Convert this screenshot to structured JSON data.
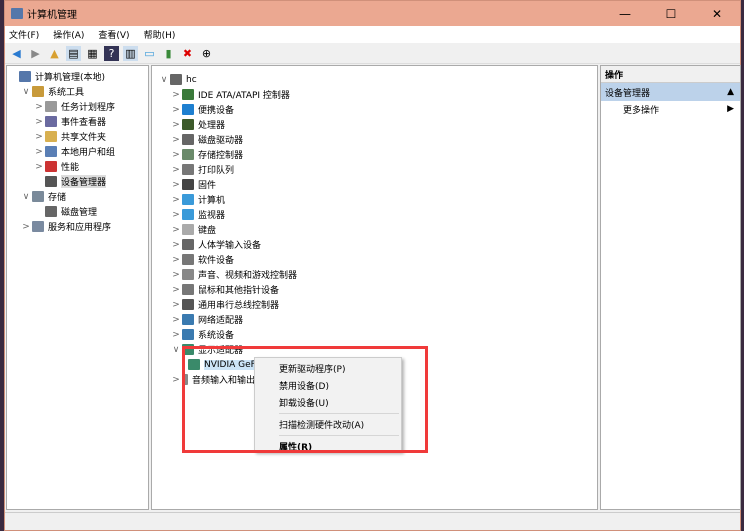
{
  "window": {
    "title": "计算机管理",
    "controls": [
      "—",
      "☐",
      "✕"
    ]
  },
  "menu": [
    "文件(F)",
    "操作(A)",
    "查看(V)",
    "帮助(H)"
  ],
  "left_tree": [
    {
      "label": "计算机管理(本地)",
      "level": 0,
      "chev": "",
      "color": "#5577aa"
    },
    {
      "label": "系统工具",
      "level": 1,
      "chev": "∨",
      "color": "#c89a3a"
    },
    {
      "label": "任务计划程序",
      "level": 2,
      "chev": ">",
      "color": "#999"
    },
    {
      "label": "事件查看器",
      "level": 2,
      "chev": ">",
      "color": "#6a6aa0"
    },
    {
      "label": "共享文件夹",
      "level": 2,
      "chev": ">",
      "color": "#d8b050"
    },
    {
      "label": "本地用户和组",
      "level": 2,
      "chev": ">",
      "color": "#5a7fb5"
    },
    {
      "label": "性能",
      "level": 2,
      "chev": ">",
      "color": "#c33"
    },
    {
      "label": "设备管理器",
      "level": 2,
      "chev": "",
      "color": "#555",
      "selected": true
    },
    {
      "label": "存储",
      "level": 1,
      "chev": "∨",
      "color": "#7a8a9a"
    },
    {
      "label": "磁盘管理",
      "level": 2,
      "chev": "",
      "color": "#666"
    },
    {
      "label": "服务和应用程序",
      "level": 1,
      "chev": ">",
      "color": "#7a8aa0"
    }
  ],
  "device_tree": {
    "root": "hc",
    "items": [
      {
        "label": "IDE ATA/ATAPI 控制器",
        "color": "#3a7a3a"
      },
      {
        "label": "便携设备",
        "color": "#1e7fd0"
      },
      {
        "label": "处理器",
        "color": "#3c5a2a"
      },
      {
        "label": "磁盘驱动器",
        "color": "#666"
      },
      {
        "label": "存储控制器",
        "color": "#6a8a6a"
      },
      {
        "label": "打印队列",
        "color": "#777"
      },
      {
        "label": "固件",
        "color": "#444"
      },
      {
        "label": "计算机",
        "color": "#3a9ad9"
      },
      {
        "label": "监视器",
        "color": "#3a9ad9"
      },
      {
        "label": "键盘",
        "color": "#aaa"
      },
      {
        "label": "人体学输入设备",
        "color": "#666"
      },
      {
        "label": "软件设备",
        "color": "#777"
      },
      {
        "label": "声音、视频和游戏控制器",
        "color": "#888"
      },
      {
        "label": "鼠标和其他指针设备",
        "color": "#777"
      },
      {
        "label": "通用串行总线控制器",
        "color": "#555"
      },
      {
        "label": "网络适配器",
        "color": "#3a7ab0"
      },
      {
        "label": "系统设备",
        "color": "#3a7ab0"
      },
      {
        "label": "显示适配器",
        "color": "#3a8a6a",
        "expanded": true
      }
    ],
    "child": "NVIDIA GeForce GTX 1650",
    "after": "音频输入和输出"
  },
  "actions": {
    "header": "操作",
    "section": "设备管理器",
    "item": "更多操作"
  },
  "context_menu": {
    "items": [
      "更新驱动程序(P)",
      "禁用设备(D)",
      "卸载设备(U)"
    ],
    "scan": "扫描检测硬件改动(A)",
    "properties": "属性(R)"
  },
  "highlight_color": "#f03a3a"
}
